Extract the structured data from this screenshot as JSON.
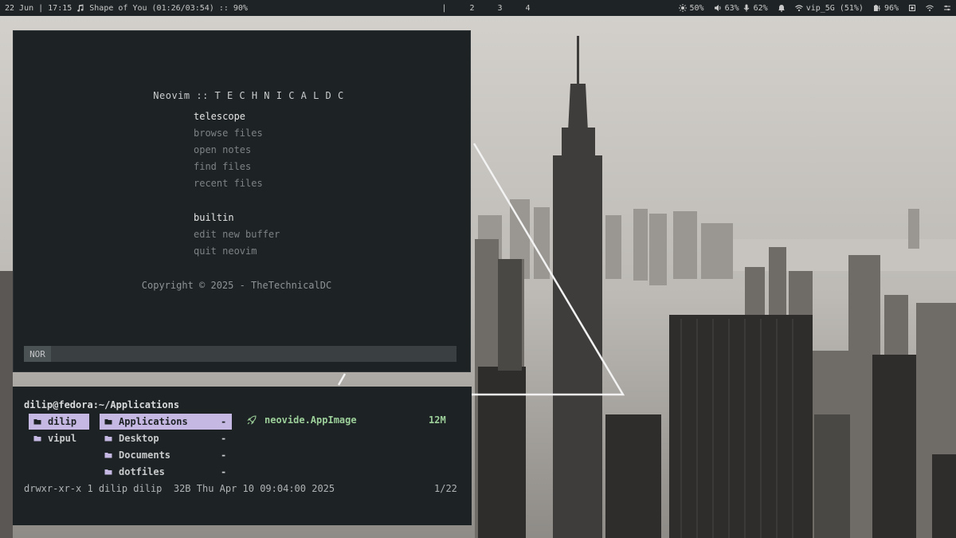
{
  "topbar": {
    "date": "22 Jun",
    "time": "17:15",
    "music": "Shape of You (01:26/03:54) :: 90%",
    "workspaces": [
      "|",
      "2",
      "3",
      "4"
    ],
    "brightness": "50%",
    "volume": "63%",
    "mic": "62%",
    "wifi": "vip_5G (51%)",
    "battery": "96%"
  },
  "nvim": {
    "header": "Neovim :: T E C H N I C A L D C",
    "sections": [
      {
        "title": "telescope",
        "items": [
          "browse files",
          "open notes",
          "find files",
          "recent files"
        ]
      },
      {
        "title": "builtin",
        "items": [
          "edit new buffer",
          "quit neovim"
        ]
      }
    ],
    "copyright": "Copyright © 2025 - TheTechnicalDC",
    "mode": "NOR"
  },
  "fm": {
    "path": "dilip@fedora:~/Applications",
    "parent": [
      "dilip",
      "vipul"
    ],
    "current": [
      "Applications",
      "Desktop",
      "Documents",
      "dotfiles"
    ],
    "dash": "-",
    "file_name": "neovide.AppImage",
    "file_size": "12M",
    "permissions": "drwxr-xr-x 1 dilip dilip  32B Thu Apr 10 09:04:00 2025",
    "position": "1/22"
  },
  "colors": {
    "accent": "#c5b9e3",
    "file": "#9ccf9a",
    "bar": "#1e2325",
    "window": "#1d2224"
  }
}
